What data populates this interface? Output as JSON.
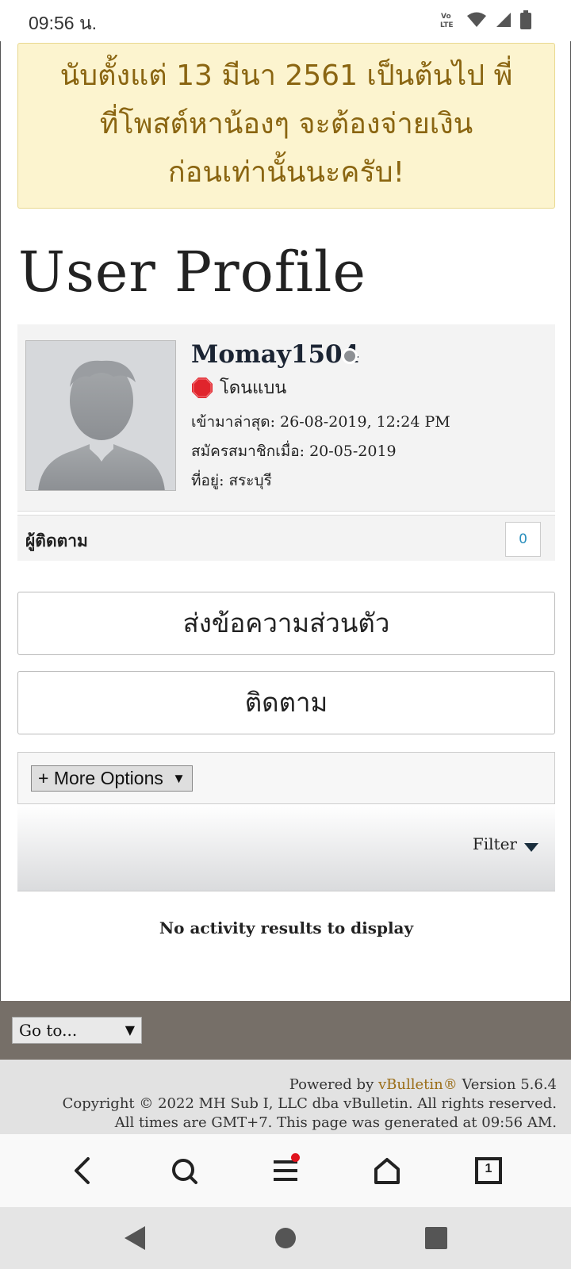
{
  "status_bar": {
    "time": "09:56 น."
  },
  "notice": {
    "line1": "นับตั้งแต่ 13 มีนา 2561 เป็นต้นไป พี่",
    "line2": "ที่โพสต์หาน้องๆ จะต้องจ่ายเงิน",
    "line3": "ก่อนเท่านั้นนะครับ!"
  },
  "page_title": "User Profile",
  "profile": {
    "username": "Momay1504",
    "status_label": "โดนแบน",
    "last_visit": "เข้ามาล่าสุด: 26-08-2019, 12:24 PM",
    "join_date": "สมัครสมาชิกเมื่อ: 20-05-2019",
    "location": "ที่อยู่: สระบุรี"
  },
  "followers": {
    "label": "ผู้ติดตาม",
    "count": "0"
  },
  "buttons": {
    "private_message": "ส่งข้อความส่วนตัว",
    "follow": "ติดตาม",
    "more_options": "+ More Options",
    "more_options_caret": "▼"
  },
  "filter": {
    "label": "Filter"
  },
  "activity": {
    "empty_message": "No activity results to display"
  },
  "footer": {
    "goto": "Go to...",
    "goto_caret": "▼",
    "powered_prefix": "Powered by ",
    "powered_brand": "vBulletin®",
    "powered_suffix": " Version 5.6.4",
    "copyright": "Copyright © 2022 MH Sub I, LLC dba vBulletin. All rights reserved.",
    "times": "All times are GMT+7. This page was generated at 09:56 AM."
  },
  "browser_nav": {
    "tab_count": "1"
  },
  "colors": {
    "notice_bg": "#fcf4cf",
    "notice_text": "#8a6511",
    "followers_count": "#2a8fbd",
    "brand_link": "#9a6c16",
    "footer_bar": "#766f68"
  },
  "icons": [
    "volte-icon",
    "wifi-icon",
    "signal-icon",
    "battery-icon",
    "stop-sign-icon",
    "back-icon",
    "search-icon",
    "menu-icon",
    "home-icon",
    "tabs-icon",
    "system-back-icon",
    "system-home-icon",
    "system-recents-icon"
  ]
}
